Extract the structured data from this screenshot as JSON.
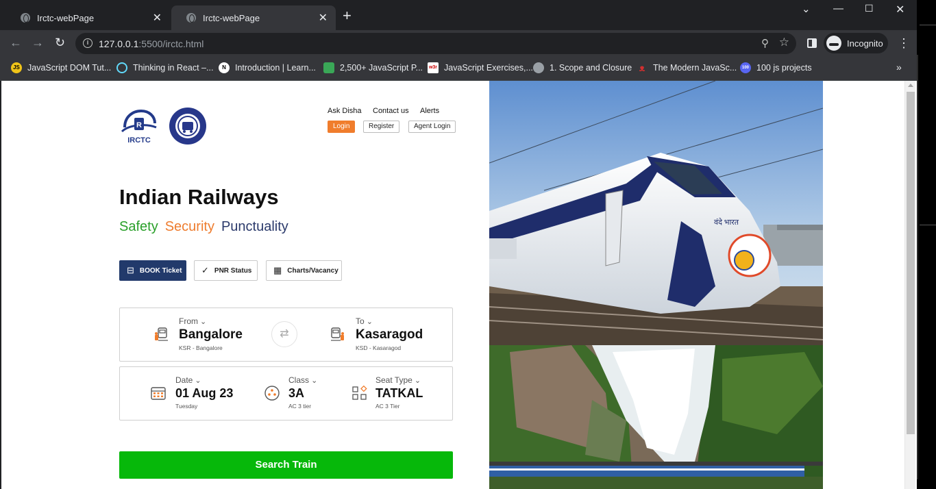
{
  "browser": {
    "tabs": [
      {
        "title": "Irctc-webPage",
        "active": false
      },
      {
        "title": "Irctc-webPage",
        "active": true
      }
    ],
    "url_host": "127.0.0.1",
    "url_rest": ":5500/irctc.html",
    "profile_label": "Incognito",
    "bookmarks": [
      {
        "label": "JavaScript DOM Tut...",
        "icon": "js-icon",
        "fav_text": "JS",
        "color": "#f0c419"
      },
      {
        "label": "Thinking in React –...",
        "icon": "react-icon",
        "fav_text": "",
        "color": "#61dafb"
      },
      {
        "label": "Introduction | Learn...",
        "icon": "next-icon",
        "fav_text": "N",
        "color": "#ffffff"
      },
      {
        "label": "2,500+ JavaScript P...",
        "icon": "w3resource-icon",
        "fav_text": "",
        "color": "#3aa757"
      },
      {
        "label": "JavaScript Exercises,...",
        "icon": "w3r-icon",
        "fav_text": "w3r",
        "color": "#ffffff"
      },
      {
        "label": "1. Scope and Closure",
        "icon": "globe-icon",
        "fav_text": "",
        "color": "#9aa0a6"
      },
      {
        "label": "The Modern JavaSc...",
        "icon": "javascript-info-icon",
        "fav_text": "",
        "color": "#d32f2f"
      },
      {
        "label": "100 js projects",
        "icon": "jsprojects-icon",
        "fav_text": "100",
        "color": "#5865f2"
      }
    ]
  },
  "page": {
    "top_links": [
      "Ask Disha",
      "Contact us",
      "Alerts"
    ],
    "auth_buttons": {
      "login": "Login",
      "register": "Register",
      "agent_login": "Agent Login"
    },
    "logo_text": "IRCTC",
    "heading": "Indian Railways",
    "tagline": {
      "safety": "Safety",
      "security": "Security",
      "punctuality": "Punctuality"
    },
    "tag_colors": {
      "safety": "#2aa02a",
      "security": "#ee7c2e",
      "punctuality": "#2b3a6b"
    },
    "tabs": [
      {
        "label": "BOOK Ticket",
        "icon": "ticket-icon",
        "active": true
      },
      {
        "label": "PNR Status",
        "icon": "check-icon",
        "active": false
      },
      {
        "label": "Charts/Vacancy",
        "icon": "chart-icon",
        "active": false
      }
    ],
    "journey": {
      "from": {
        "label": "From",
        "value": "Bangalore",
        "sub": "KSR - Bangalore"
      },
      "to": {
        "label": "To",
        "value": "Kasaragod",
        "sub": "KSD - Kasaragod"
      }
    },
    "options": {
      "date": {
        "label": "Date",
        "value": "01 Aug 23",
        "sub": "Tuesday"
      },
      "class": {
        "label": "Class",
        "value": "3A",
        "sub": "AC 3 tier"
      },
      "seat": {
        "label": "Seat Type",
        "value": "TATKAL",
        "sub": "AC 3 Tier"
      }
    },
    "search_button": "Search Train",
    "accent": "#06b80a",
    "primary": "#223a6b",
    "orange": "#f07d2c"
  }
}
